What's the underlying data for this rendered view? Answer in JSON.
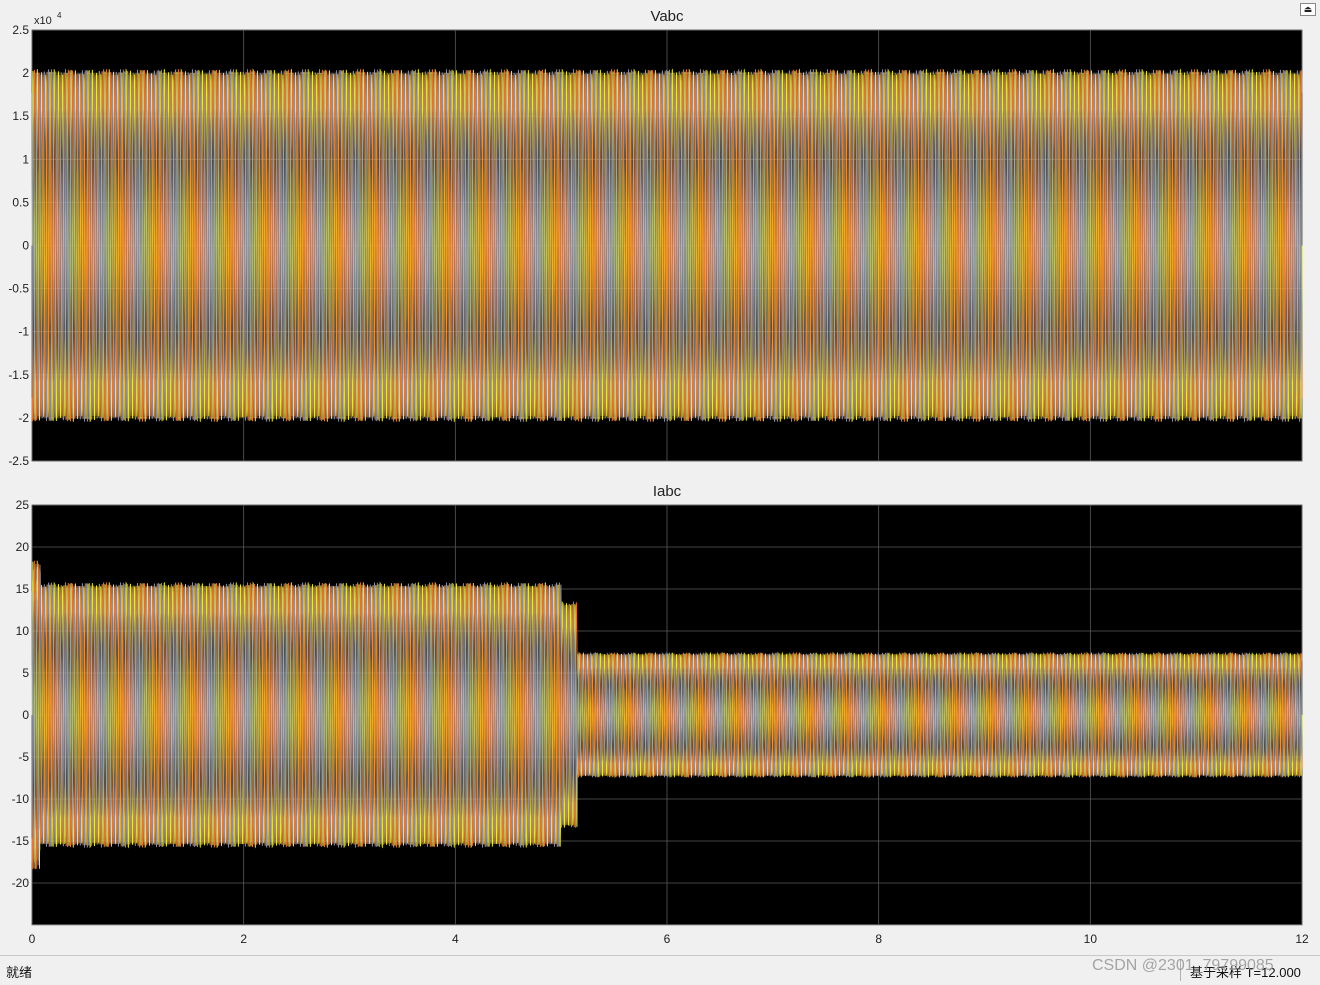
{
  "window": {
    "undock_symbol": "⏏"
  },
  "status": {
    "left": "就绪",
    "right": "基于采样  T=12.000"
  },
  "watermark": "CSDN @2301_79799085",
  "colors": {
    "figure_bg": "#f0f0f0",
    "plot_bg": "#000000",
    "grid": "#5a5a5a",
    "axis_text": "#222222",
    "series": [
      "#ffff2d",
      "#ff7b2e",
      "#8f9bb3"
    ]
  },
  "chart_data": [
    {
      "type": "line",
      "title": "Vabc",
      "xlabel": "",
      "ylabel": "",
      "exponent_label": "x10",
      "exponent_power": "4",
      "xlim": [
        0,
        12
      ],
      "ylim": [
        -2.5,
        2.5
      ],
      "xticks": [
        0,
        2,
        4,
        6,
        8,
        10,
        12
      ],
      "xtick_labels": [
        "",
        "",
        "",
        "",
        "",
        "",
        ""
      ],
      "yticks": [
        2.5,
        2,
        1.5,
        1,
        0.5,
        0,
        -0.5,
        -1,
        -1.5,
        -2,
        -2.5
      ],
      "ytick_labels": [
        "2.5",
        "2",
        "1.5",
        "1",
        "0.5",
        "0",
        "-0.5",
        "-1",
        "-1.5",
        "-2",
        "-2.5"
      ],
      "grid": true,
      "series": [
        {
          "phase_deg": 0,
          "amplitude_segments": [
            {
              "x": [
                0,
                12
              ],
              "amplitude": 2.05
            }
          ]
        },
        {
          "phase_deg": -120,
          "amplitude_segments": [
            {
              "x": [
                0,
                12
              ],
              "amplitude": 2.05
            }
          ]
        },
        {
          "phase_deg": 120,
          "amplitude_segments": [
            {
              "x": [
                0,
                12
              ],
              "amplitude": 2.05
            }
          ]
        }
      ]
    },
    {
      "type": "line",
      "title": "Iabc",
      "xlabel": "",
      "ylabel": "",
      "xlim": [
        0,
        12
      ],
      "ylim": [
        -25,
        25
      ],
      "xticks": [
        0,
        2,
        4,
        6,
        8,
        10,
        12
      ],
      "xtick_labels": [
        "0",
        "2",
        "4",
        "6",
        "8",
        "10",
        "12"
      ],
      "yticks": [
        25,
        20,
        15,
        10,
        5,
        0,
        -5,
        -10,
        -15,
        -20
      ],
      "ytick_labels": [
        "25",
        "20",
        "15",
        "10",
        "5",
        "0",
        "-5",
        "-10",
        "-15",
        "-20"
      ],
      "grid": true,
      "series": [
        {
          "phase_deg": 0,
          "amplitude_segments": [
            {
              "x": [
                0,
                5.0
              ],
              "amplitude": 15.8
            },
            {
              "x": [
                5.0,
                5.15
              ],
              "amplitude": 13.5
            },
            {
              "x": [
                5.15,
                12
              ],
              "amplitude": 7.4
            }
          ]
        },
        {
          "phase_deg": -120,
          "amplitude_segments": [
            {
              "x": [
                0,
                5.0
              ],
              "amplitude": 15.8
            },
            {
              "x": [
                5.0,
                5.15
              ],
              "amplitude": 13.5
            },
            {
              "x": [
                5.15,
                12
              ],
              "amplitude": 7.4
            }
          ]
        },
        {
          "phase_deg": 120,
          "amplitude_segments": [
            {
              "x": [
                0,
                5.0
              ],
              "amplitude": 15.8
            },
            {
              "x": [
                5.0,
                5.15
              ],
              "amplitude": 13.5
            },
            {
              "x": [
                5.15,
                12
              ],
              "amplitude": 7.4
            }
          ]
        }
      ],
      "transient": {
        "x": [
          0,
          0.08
        ],
        "peak_low": -18.5,
        "peak_high": 17
      }
    }
  ]
}
